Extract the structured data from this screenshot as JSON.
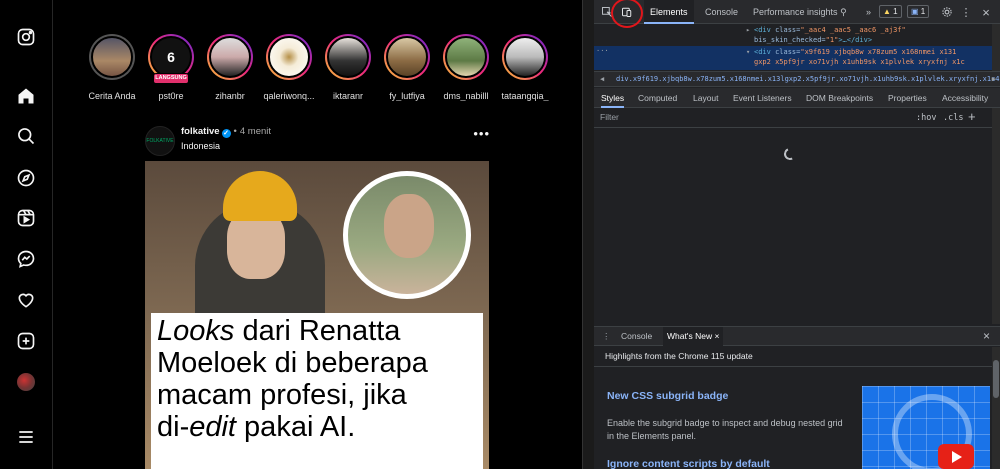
{
  "instagram": {
    "nav_icons": [
      "instagram-logo-icon",
      "home-icon",
      "search-icon",
      "explore-icon",
      "reels-icon",
      "messenger-icon",
      "heart-icon",
      "create-icon",
      "profile-avatar",
      "menu-icon"
    ],
    "stories": [
      {
        "name": "Cerita Anda",
        "seen": true
      },
      {
        "name": "pst0re",
        "seen": false,
        "live": "LANGSUNG"
      },
      {
        "name": "zihanbr",
        "seen": false
      },
      {
        "name": "qaleriwonq...",
        "seen": false
      },
      {
        "name": "iktaranr",
        "seen": false
      },
      {
        "name": "fy_lutfiya",
        "seen": false
      },
      {
        "name": "dms_nabilll",
        "seen": false
      },
      {
        "name": "tataangqia_",
        "seen": false
      }
    ],
    "post": {
      "username": "folkative",
      "verified_mark": "✓",
      "separator": "•",
      "time": "4 menit",
      "location": "Indonesia",
      "more": "•••",
      "avatar_text": "FOLKATIVE",
      "caption_line1_italic": "Looks",
      "caption_line1_rest": " dari Renatta",
      "caption_line2": "Moeloek di beberapa",
      "caption_line3": "macam profesi, jika",
      "caption_line4_pre": "di-",
      "caption_line4_italic": "edit",
      "caption_line4_post": " pakai AI."
    }
  },
  "devtools": {
    "tabs": [
      "Elements",
      "Console",
      "Performance insights"
    ],
    "active_tab": "Elements",
    "more_tabs": "»",
    "warning_count": "1",
    "message_count": "1",
    "dom": {
      "line1_tag_open": "<div",
      "line1_attr": " class=",
      "line1_val": "\"_aac4 _aac5 _aac6 _aj3f\"",
      "line2_attr": "bis_skin_checked=",
      "line2_val": "\"1\"",
      "line2_tail": ">…</div>",
      "sel_tag": "<div",
      "sel_attr": " class=",
      "sel_val": "\"x9f619 xjbqb8w x78zum5 x168nmei x131",
      "sel_line2": "gxp2 x5pf9jr xo71vjh x1uhb9sk x1plvlek xryxfnj x1c"
    },
    "breadcrumb": "div.x9f619.xjbqb8w.x78zum5.x168nmei.x13lgxp2.x5pf9jr.xo71vjh.x1uhb9sk.x1plvlek.xryxfnj.x1c4",
    "sub_tabs": [
      "Styles",
      "Computed",
      "Layout",
      "Event Listeners",
      "DOM Breakpoints",
      "Properties",
      "Accessibility"
    ],
    "active_sub_tab": "Styles",
    "filter_placeholder": "Filter",
    "hov": ":hov",
    "cls": ".cls",
    "plus": "+",
    "drawer_tabs": [
      "Console",
      "What's New"
    ],
    "active_drawer_tab": "What's New",
    "close_glyph": "×",
    "whats_new": {
      "title": "Highlights from the Chrome 115 update",
      "h1": "New CSS subgrid badge",
      "p1": "Enable the subgrid badge to inspect and debug nested grid in the Elements panel.",
      "h2": "Ignore content scripts by default"
    }
  }
}
